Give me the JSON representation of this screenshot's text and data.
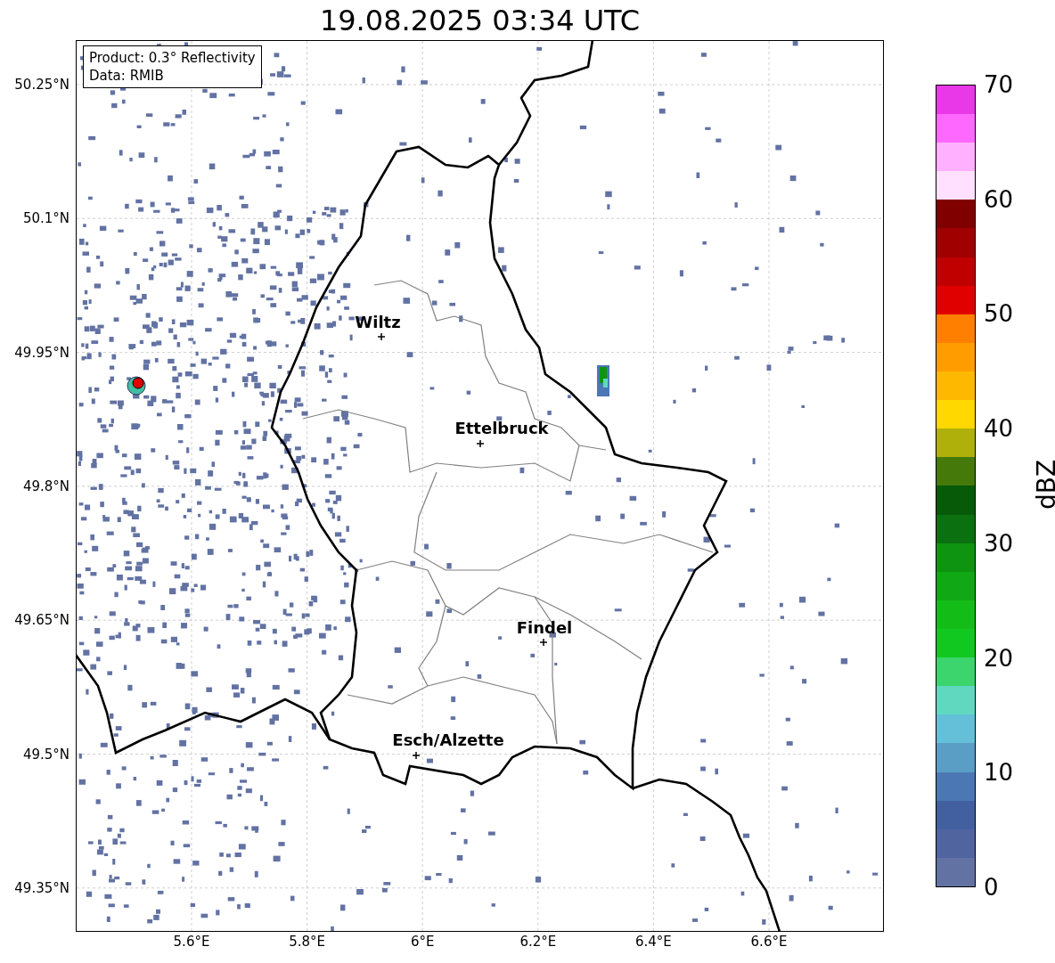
{
  "title": "19.08.2025 03:34 UTC",
  "legend": [
    "Product: 0.3° Reflectivity",
    "Data: RMIB"
  ],
  "lat_ticks": [
    "50.25°N",
    "50.1°N",
    "49.95°N",
    "49.8°N",
    "49.65°N",
    "49.5°N",
    "49.35°N"
  ],
  "lon_ticks": [
    "5.6°E",
    "5.8°E",
    "6°E",
    "6.2°E",
    "6.4°E",
    "6.6°E"
  ],
  "cities": [
    {
      "name": "Wiltz"
    },
    {
      "name": "Ettelbruck"
    },
    {
      "name": "Findel"
    },
    {
      "name": "Esch/Alzette"
    }
  ],
  "colorbar": {
    "label": "dBZ",
    "ticks": [
      "70",
      "60",
      "50",
      "40",
      "30",
      "20",
      "10",
      "0"
    ],
    "bands": [
      {
        "color": "#6272a3"
      },
      {
        "color": "#5064a0"
      },
      {
        "color": "#4260a0"
      },
      {
        "color": "#4b78b4"
      },
      {
        "color": "#5a9ec6"
      },
      {
        "color": "#64c0d8"
      },
      {
        "color": "#60d8c0"
      },
      {
        "color": "#3cd46c"
      },
      {
        "color": "#10c820"
      },
      {
        "color": "#14bc18"
      },
      {
        "color": "#10a814"
      },
      {
        "color": "#0e9410"
      },
      {
        "color": "#0a7010"
      },
      {
        "color": "#065a08"
      },
      {
        "color": "#457a0a"
      },
      {
        "color": "#b0b00a"
      },
      {
        "color": "#ffd800"
      },
      {
        "color": "#ffb800"
      },
      {
        "color": "#ff9c00"
      },
      {
        "color": "#ff8000"
      },
      {
        "color": "#e00000"
      },
      {
        "color": "#c00000"
      },
      {
        "color": "#a00000"
      },
      {
        "color": "#800000"
      },
      {
        "color": "#ffe0ff"
      },
      {
        "color": "#ffb0ff"
      },
      {
        "color": "#ff68ff"
      },
      {
        "color": "#e838e8"
      }
    ]
  }
}
